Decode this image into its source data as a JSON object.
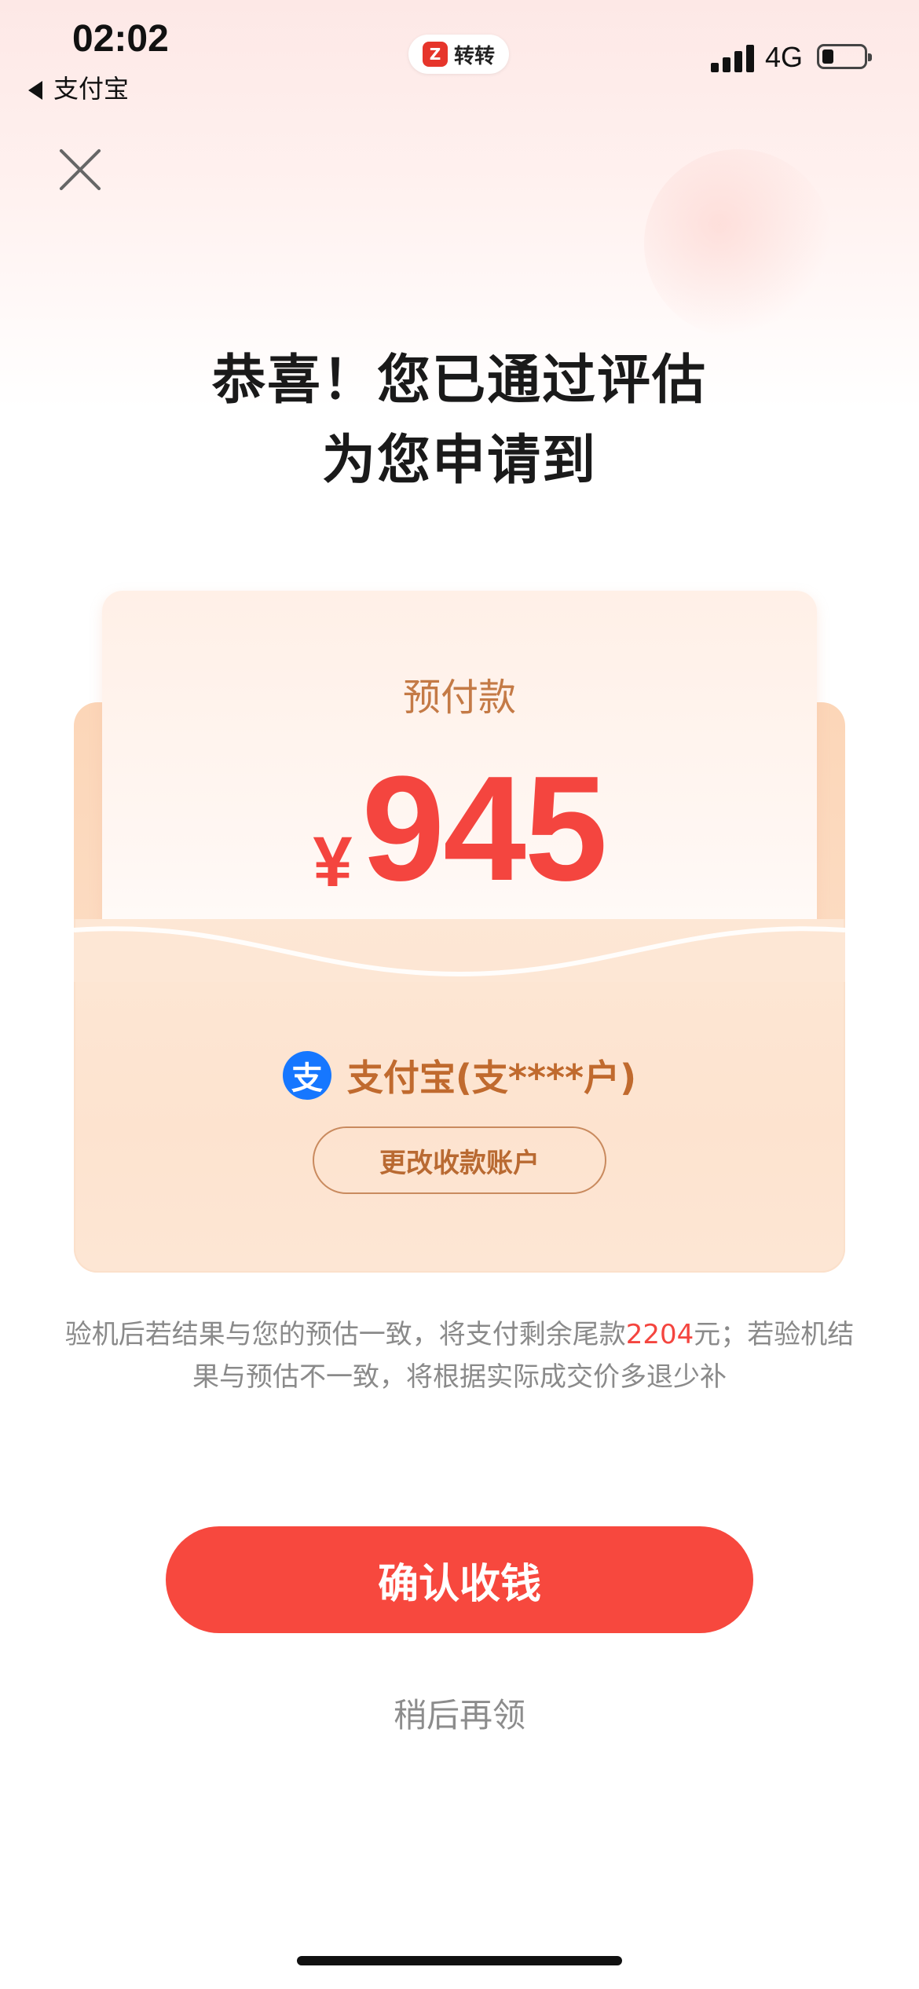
{
  "status_bar": {
    "time": "02:02",
    "back_app": "支付宝",
    "app_pill": "转转",
    "network": "4G"
  },
  "header": {
    "title_line1": "恭喜！您已通过评估",
    "title_line2": "为您申请到"
  },
  "card": {
    "label": "预付款",
    "currency": "¥",
    "amount": "945",
    "account_icon_char": "支",
    "account": "支付宝(支****户)",
    "change_account_label": "更改收款账户"
  },
  "note": {
    "part1": "验机后若结果与您的预估一致，将支付剩余尾款",
    "remaining_amount": "2204",
    "part2": "元；若验机结果与预估不一致，将根据实际成交价多退少补"
  },
  "actions": {
    "confirm_label": "确认收钱",
    "later_label": "稍后再领"
  },
  "colors": {
    "accent": "#f7483e",
    "amount": "#f4453f",
    "brand_alipay": "#1677ff",
    "card_label": "#c47a46"
  },
  "icons": [
    "close-icon",
    "back-arrow-icon",
    "signal-icon",
    "battery-icon",
    "alipay-icon"
  ]
}
